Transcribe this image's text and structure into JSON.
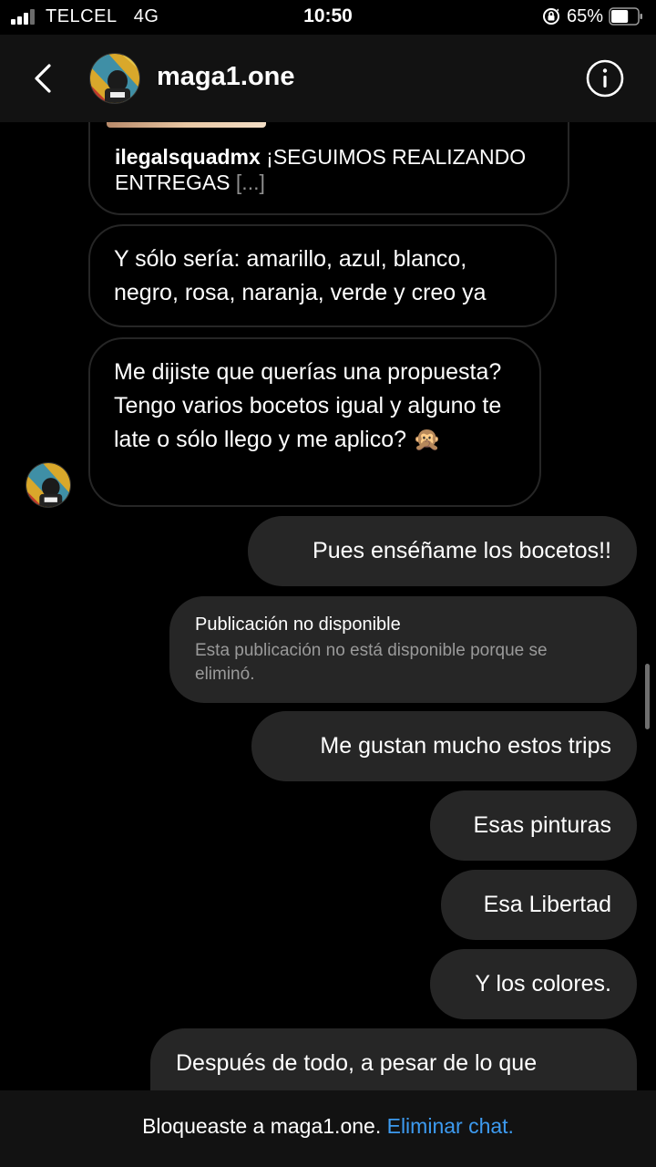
{
  "status_bar": {
    "carrier": "TELCEL",
    "network": "4G",
    "time": "10:50",
    "battery": "65%",
    "battery_level": 0.65,
    "signal_bars": 3
  },
  "header": {
    "title": "maga1.one",
    "back_icon": "chevron-left-icon",
    "info_icon": "info-circle-icon"
  },
  "messages": {
    "shared_post": {
      "username": "ilegalsquadmx",
      "caption": "¡SEGUIMOS REALIZANDO ENTREGAS",
      "more": "[...]"
    },
    "incoming": [
      "Y sólo sería: amarillo, azul, blanco, negro, rosa, naranja, verde y creo ya",
      "Me dijiste que querías una propuesta? Tengo varios bocetos igual y alguno te late o sólo llego y me aplico? 🙊"
    ],
    "outgoing_1": "Pues enséñame los bocetos!!",
    "unavailable": {
      "title": "Publicación no disponible",
      "description": "Esta publicación no está disponible porque se eliminó."
    },
    "outgoing": [
      "Me gustan mucho estos trips",
      "Esas pinturas",
      "Esa Libertad",
      "Y los colores.",
      "Después de todo, a pesar de lo que"
    ]
  },
  "footer": {
    "text": "Bloqueaste a maga1.one.",
    "link": "Eliminar chat."
  },
  "colors": {
    "background": "#000000",
    "bubble_outgoing": "#262626",
    "bubble_border": "#262626",
    "link": "#3d9bf0"
  }
}
